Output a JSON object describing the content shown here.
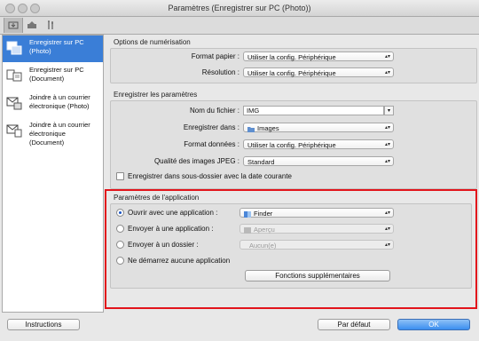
{
  "window": {
    "title": "Paramètres (Enregistrer sur PC (Photo))"
  },
  "sidebar": {
    "items": [
      {
        "line1": "Enregistrer sur PC",
        "line2": "(Photo)",
        "icon": "save-photo-icon",
        "selected": true
      },
      {
        "line1": "Enregistrer sur PC",
        "line2": "(Document)",
        "icon": "save-document-icon",
        "selected": false
      },
      {
        "line1": "Joindre à un courrier",
        "line2": "électronique (Photo)",
        "icon": "email-photo-icon",
        "selected": false
      },
      {
        "line1": "Joindre à un courrier",
        "line2": "électronique (Document)",
        "icon": "email-document-icon",
        "selected": false
      }
    ]
  },
  "scan_options": {
    "title": "Options de numérisation",
    "paper_label": "Format papier :",
    "paper_value": "Utiliser la config. Périphérique",
    "resolution_label": "Résolution :",
    "resolution_value": "Utiliser la config. Périphérique"
  },
  "save_settings": {
    "title": "Enregistrer les paramètres",
    "filename_label": "Nom du fichier :",
    "filename_value": "IMG",
    "save_in_label": "Enregistrer dans :",
    "save_in_value": "Images",
    "format_label": "Format données :",
    "format_value": "Utiliser la config. Périphérique",
    "jpeg_label": "Qualité des images JPEG :",
    "jpeg_value": "Standard",
    "subfolder_label": "Enregistrer dans sous-dossier avec la date courante"
  },
  "app_settings": {
    "title": "Paramètres de l'application",
    "open_label": "Ouvrir avec une application :",
    "open_value": "Finder",
    "send_app_label": "Envoyer à une application :",
    "send_app_value": "Aperçu",
    "send_folder_label": "Envoyer à un dossier :",
    "send_folder_value": "Aucun(e)",
    "no_app_label": "Ne démarrez aucune application",
    "more_button": "Fonctions supplémentaires"
  },
  "footer": {
    "instructions": "Instructions",
    "default": "Par défaut",
    "ok": "OK"
  },
  "colors": {
    "selection": "#3a7ed7",
    "highlight": "#e2141b",
    "ok_button": "#3a8ef0"
  }
}
